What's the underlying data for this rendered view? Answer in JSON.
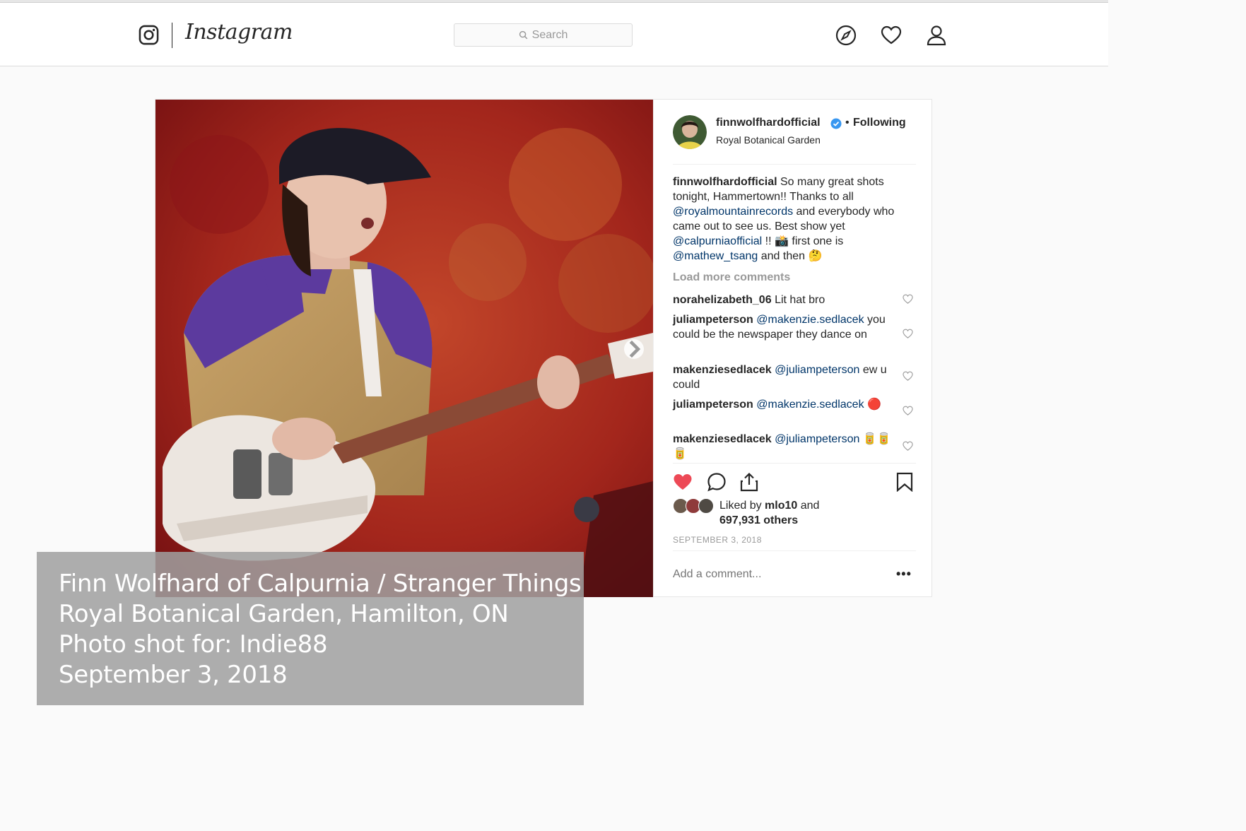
{
  "app": {
    "wordmark": "Instagram"
  },
  "search": {
    "placeholder": "Search"
  },
  "post": {
    "username": "finnwolfhardofficial",
    "follow_status": "Following",
    "location": "Royal Botanical Garden",
    "caption_user": "finnwolfhardofficial",
    "caption_parts": [
      " So many great shots tonight, Hammertown!! Thanks to all ",
      " and everybody who came out to see us. Best show yet ",
      " !! 📸 first one is ",
      " and then 🤔"
    ],
    "caption_mentions": [
      "@royalmountainrecords",
      "@calpurniaofficial",
      "@mathew_tsang"
    ],
    "load_more": "Load more comments",
    "comments": [
      {
        "user": "norahelizabeth_06",
        "mention": "",
        "text": "Lit hat bro"
      },
      {
        "user": "juliampeterson",
        "mention": "@makenzie.sedlacek",
        "text": "you could be the newspaper they dance on"
      },
      {
        "user": "makenziesedlacek",
        "mention": "@juliampeterson",
        "text": "ew u could"
      },
      {
        "user": "juliampeterson",
        "mention": "@makenzie.sedlacek",
        "text": "🔴"
      },
      {
        "user": "makenziesedlacek",
        "mention": "@juliampeterson",
        "text": "🥫🥫🥫"
      }
    ],
    "liked_by_prefix": "Liked by ",
    "liked_by_user": "mlo10",
    "liked_by_and": " and",
    "liked_by_others": "697,931 others",
    "timestamp": "SEPTEMBER 3, 2018",
    "add_comment_placeholder": "Add a comment...",
    "more_options": "•••"
  },
  "overlay": {
    "line1": "Finn Wolfhard of Calpurnia / Stranger Things",
    "line2": "Royal Botanical Garden, Hamilton, ON",
    "line3": "Photo shot for: Indie88",
    "line4": "September 3, 2018"
  },
  "colors": {
    "like_red": "#ed4956",
    "mention_blue": "#003569",
    "verified_blue": "#3897f0"
  }
}
